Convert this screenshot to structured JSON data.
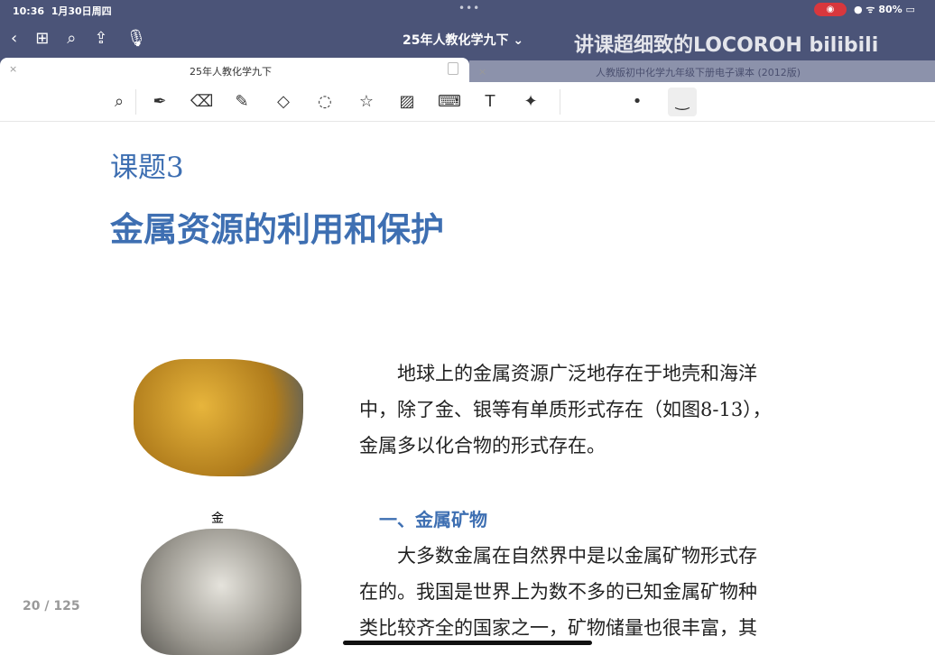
{
  "status": {
    "time": "10:36",
    "date": "1月30日周四",
    "battery": "80%"
  },
  "nav": {
    "title": "25年人教化学九下 ⌄",
    "watermark": "讲课超细致的LOCOROH bilibili"
  },
  "tabs": [
    {
      "label": "25年人教化学九下",
      "close": "×"
    },
    {
      "label": "人教版初中化学九年级下册电子课本 (2012版)",
      "close": "×"
    }
  ],
  "page": {
    "lesson": "课题3",
    "title": "金属资源的利用和保护",
    "intro": [
      "地球上的金属资源广泛地存在于地壳和海洋",
      "中，除了金、银等有单质形式存在（如图8-13），",
      "金属多以化合物的形式存在。"
    ],
    "section": "一、金属矿物",
    "body": [
      "大多数金属在自然界中是以金属矿物形式存",
      "在的。我国是世界上为数不多的已知金属矿物种",
      "类比较齐全的国家之一，矿物储量也很丰富，其"
    ],
    "gold_caption": "金"
  },
  "page_indicator": "20 / 125"
}
